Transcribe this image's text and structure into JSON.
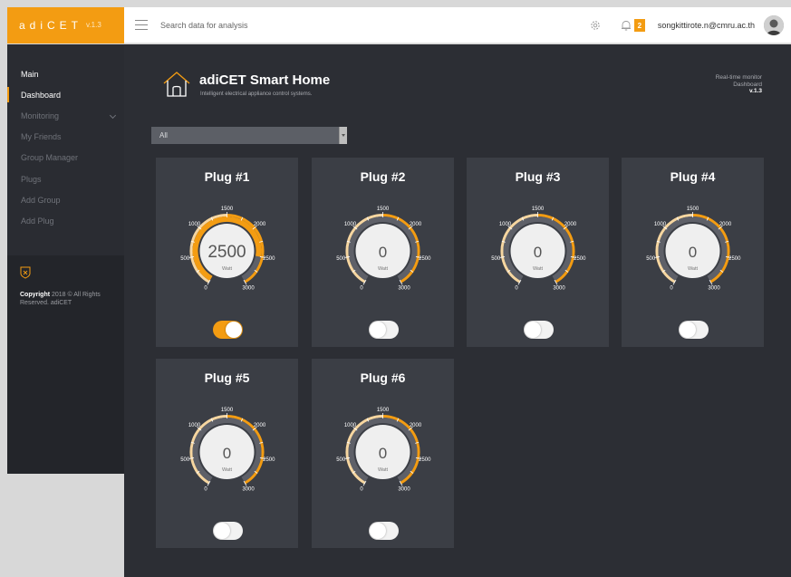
{
  "brand": {
    "name": "adiCET",
    "version": "v.1.3"
  },
  "search": {
    "placeholder": "Search data for analysis"
  },
  "notifications": {
    "count": "2"
  },
  "user": {
    "email": "songkittirote.n@cmru.ac.th"
  },
  "sidebar": {
    "items": [
      {
        "label": "Main"
      },
      {
        "label": "Dashboard"
      },
      {
        "label": "Monitoring"
      },
      {
        "label": "My Friends"
      },
      {
        "label": "Group Manager"
      },
      {
        "label": "Plugs"
      },
      {
        "label": "Add Group"
      },
      {
        "label": "Add Plug"
      }
    ],
    "copyright_bold": "Copyright",
    "copyright_rest": " 2018 © All Rights Reserved. adiCET"
  },
  "page": {
    "title": "adiCET Smart Home",
    "subtitle": "Intelligent electrical appliance control systems.",
    "rt_line1": "Real-time monitor",
    "rt_line2": "Dashboard",
    "rt_version": "v.1.3"
  },
  "filter": {
    "selected": "All"
  },
  "gauge": {
    "unit": "Watt",
    "min": 0,
    "max": 3000,
    "tick_labels": [
      "0",
      "500",
      "1000",
      "1500",
      "2000",
      "2500",
      "3000"
    ]
  },
  "plugs": [
    {
      "name": "Plug #1",
      "value": 2500,
      "on": true
    },
    {
      "name": "Plug #2",
      "value": 0,
      "on": false
    },
    {
      "name": "Plug #3",
      "value": 0,
      "on": false
    },
    {
      "name": "Plug #4",
      "value": 0,
      "on": false
    },
    {
      "name": "Plug #5",
      "value": 0,
      "on": false
    },
    {
      "name": "Plug #6",
      "value": 0,
      "on": false
    }
  ],
  "colors": {
    "accent": "#f39c12",
    "panel": "#3b3e45",
    "background": "#2c2e34",
    "sidebar": "#2a2c32"
  }
}
